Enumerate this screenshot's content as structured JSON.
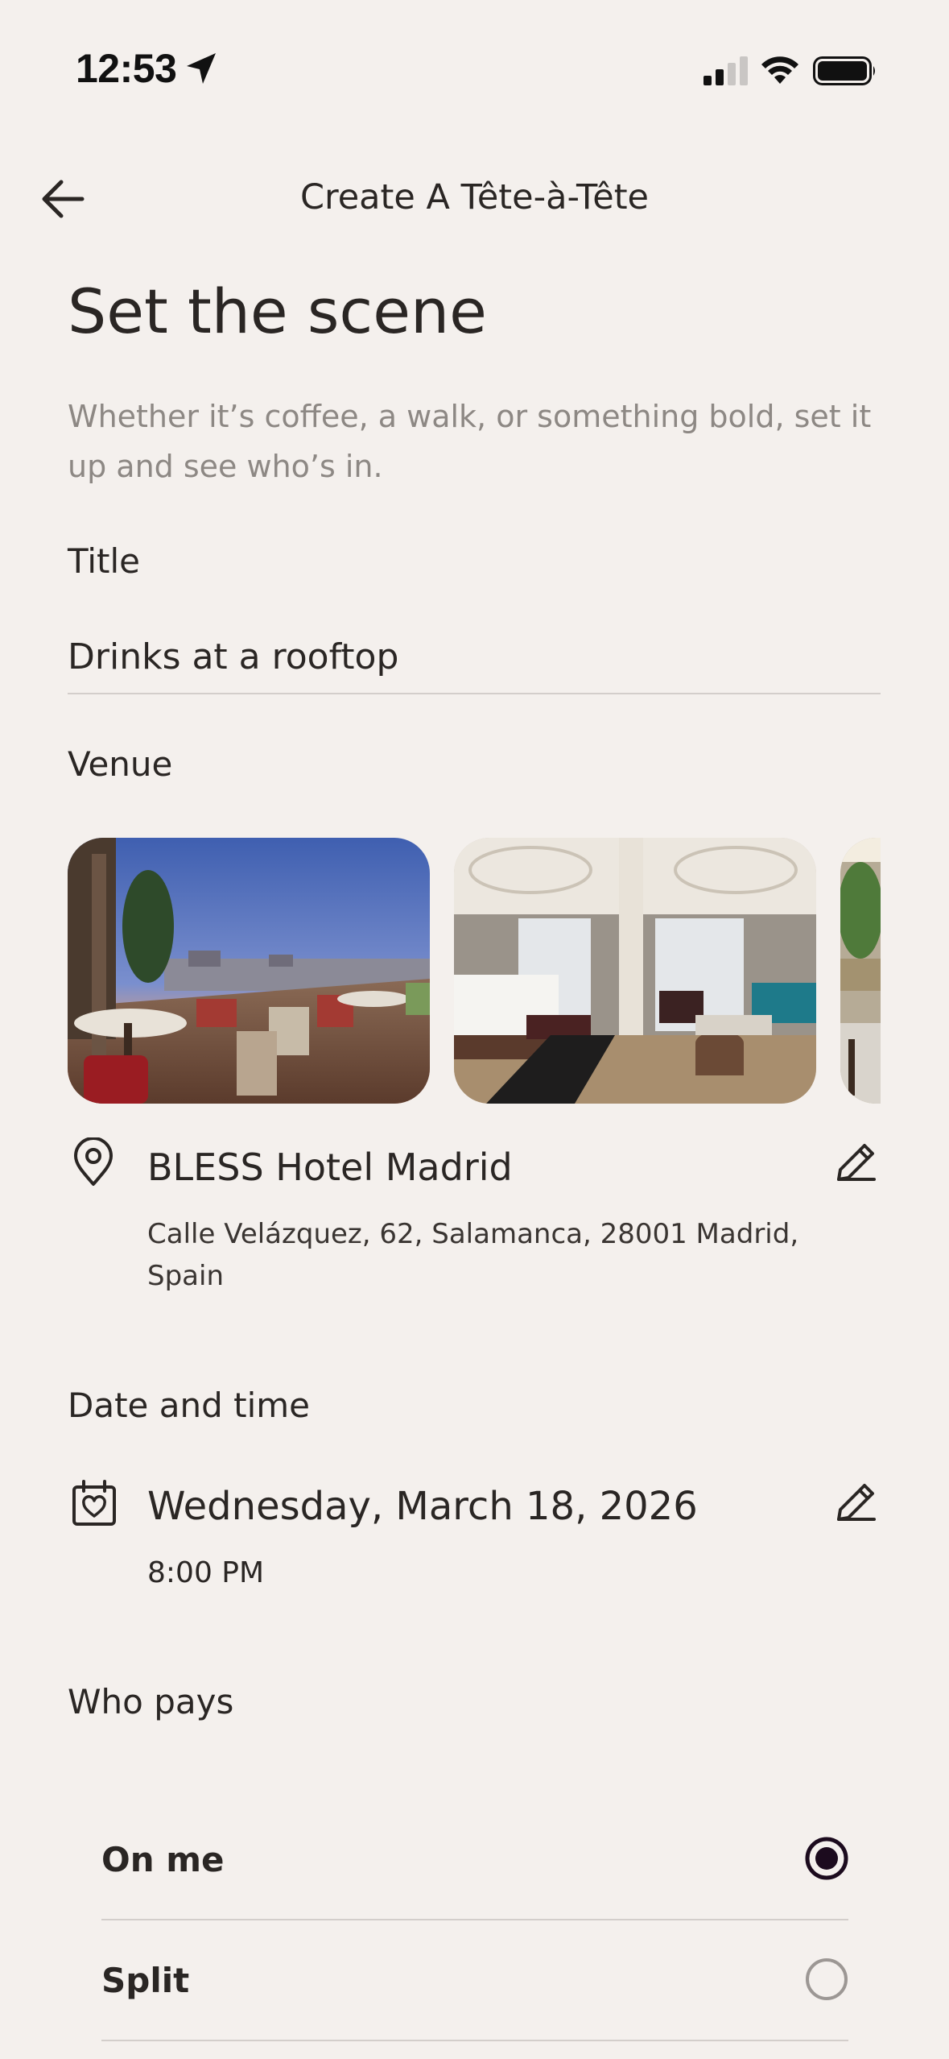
{
  "status_bar": {
    "time": "12:53",
    "icons": [
      "location-arrow-icon",
      "signal-icon",
      "wifi-icon",
      "battery-icon"
    ]
  },
  "header": {
    "title": "Create A Tête-à-Tête",
    "back_icon": "arrow-left-icon"
  },
  "page": {
    "title": "Set the scene",
    "subtitle": "Whether it’s coffee, a walk, or something bold, set it up and see who’s in."
  },
  "title_field": {
    "label": "Title",
    "value": "Drinks at a rooftop"
  },
  "venue": {
    "label": "Venue",
    "photos": [
      "rooftop-terrace-photo",
      "hotel-room-photo",
      "restaurant-photo"
    ],
    "name": "BLESS Hotel Madrid",
    "address": "Calle Velázquez, 62, Salamanca, 28001 Madrid, Spain",
    "icon": "map-pin-icon",
    "edit_icon": "pencil-icon"
  },
  "date_time": {
    "label": "Date and time",
    "date": "Wednesday, March 18, 2026",
    "time": "8:00 PM",
    "icon": "calendar-heart-icon",
    "edit_icon": "pencil-icon"
  },
  "who_pays": {
    "label": "Who pays",
    "options": [
      {
        "label": "On me",
        "selected": true
      },
      {
        "label": "Split",
        "selected": false
      }
    ]
  },
  "colors": {
    "background": "#f4f0ed",
    "text": "#2a2624",
    "muted": "#8d8884",
    "divider": "#d3cecb",
    "radio_selected": "#1c0b1e"
  }
}
